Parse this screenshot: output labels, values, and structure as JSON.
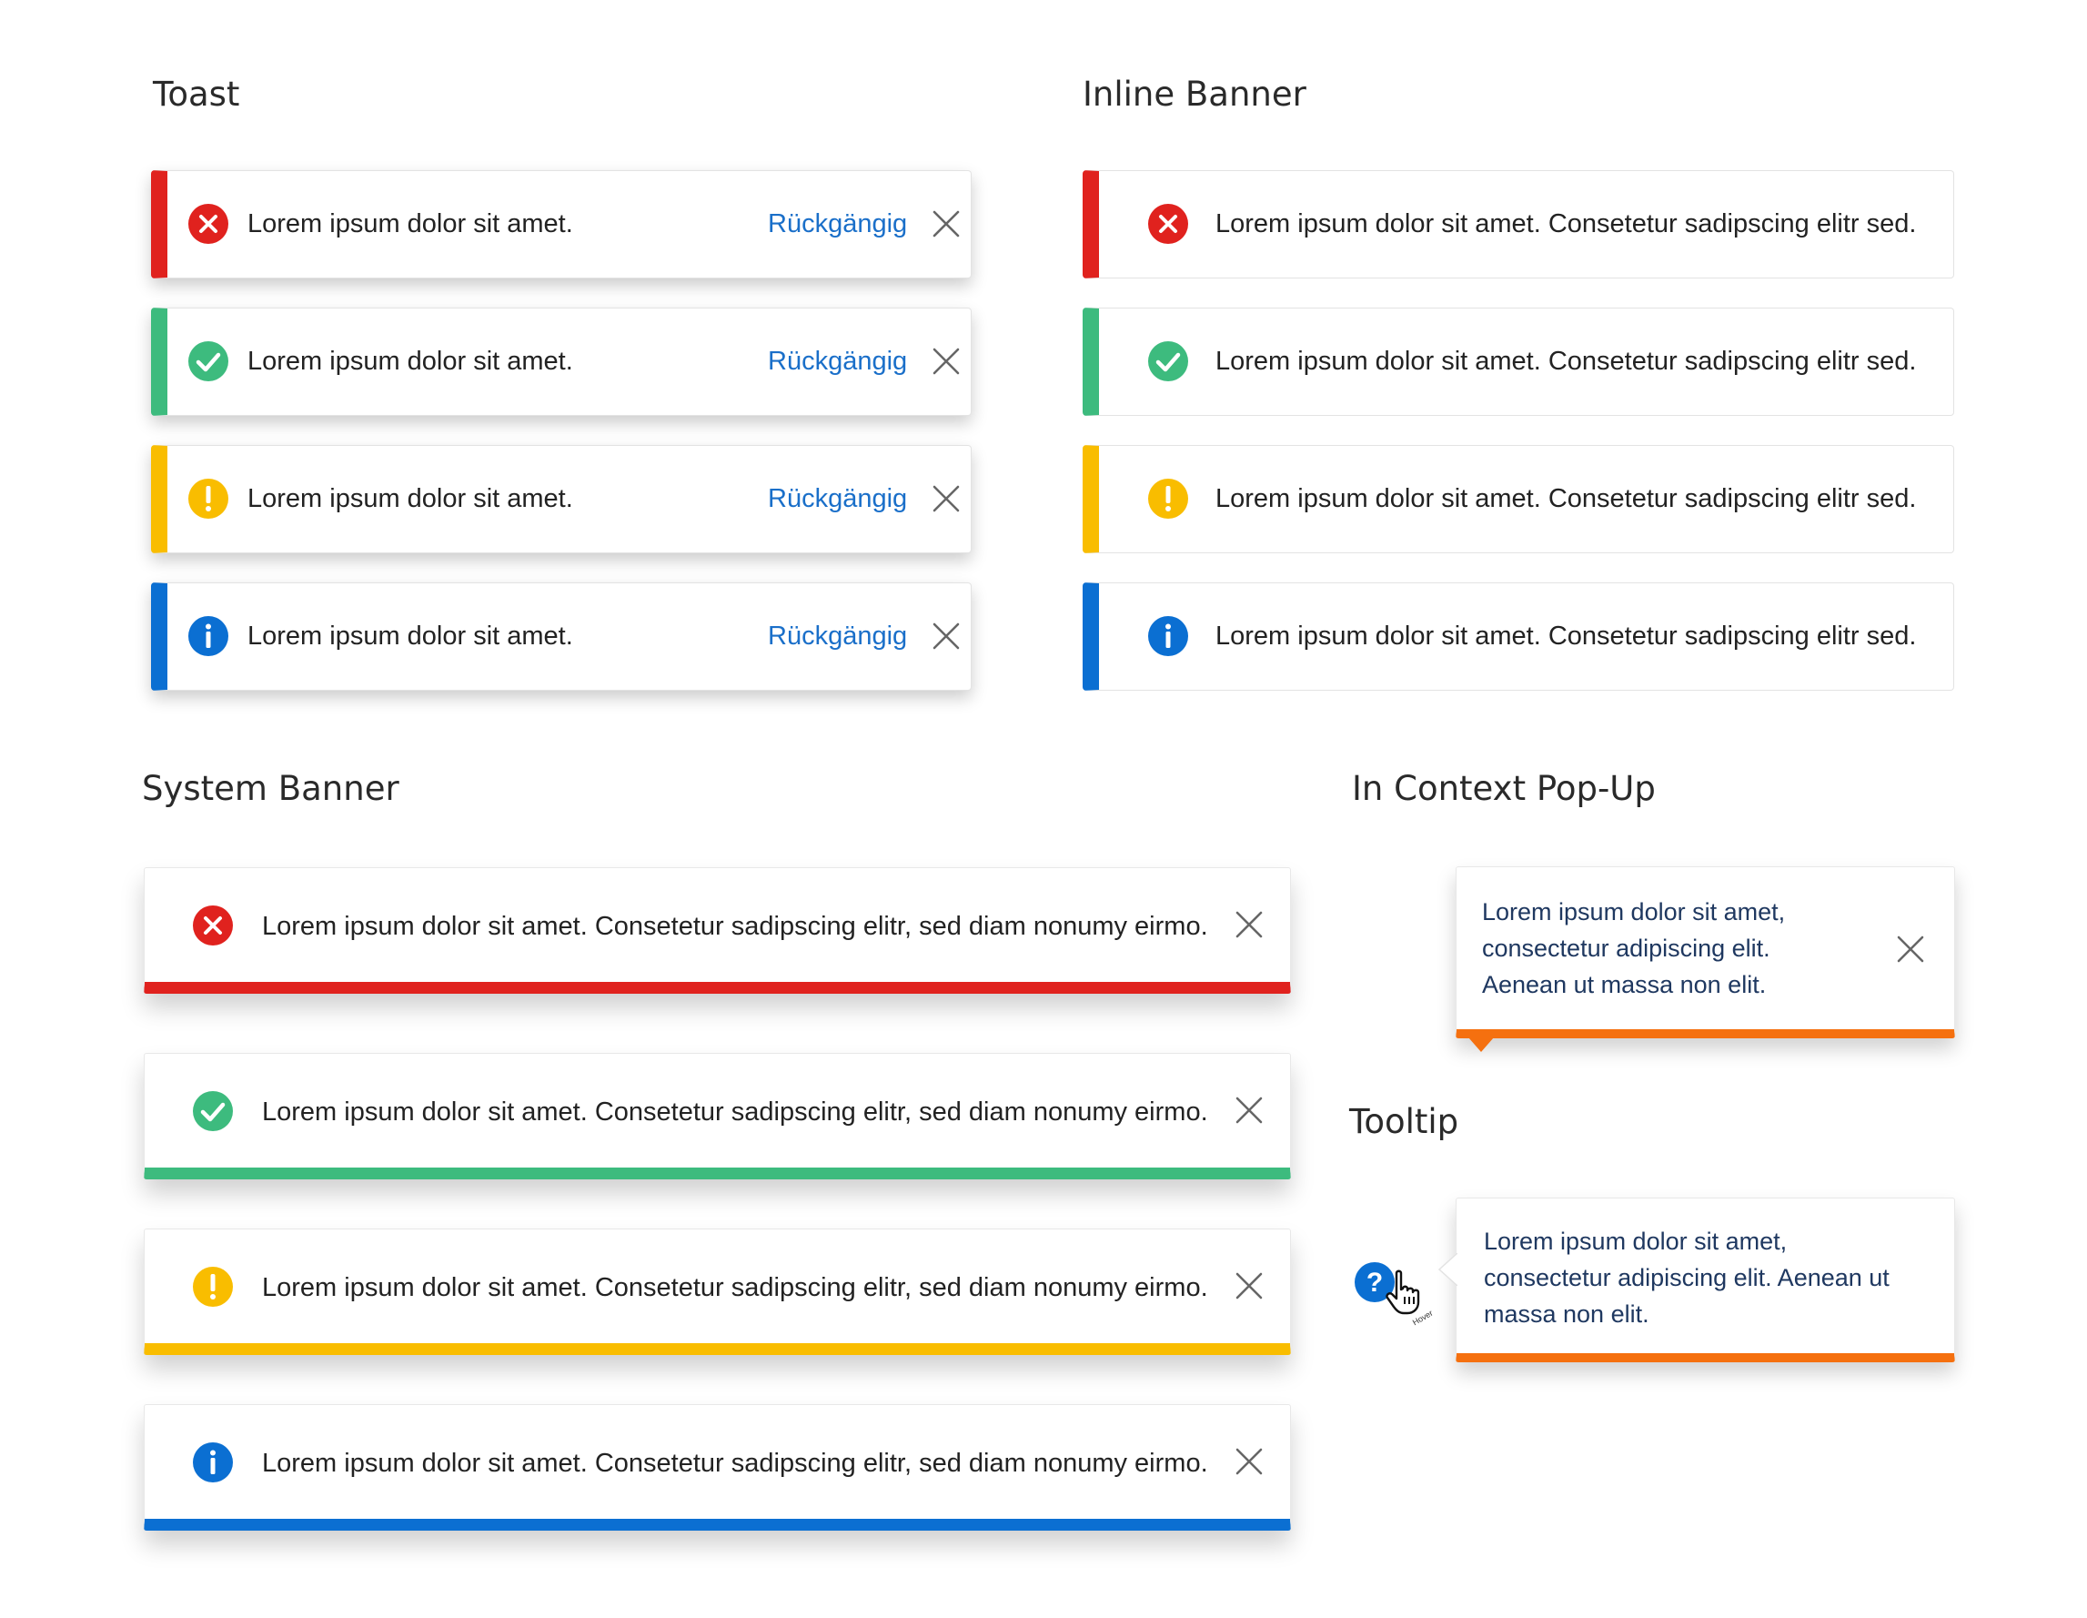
{
  "colors": {
    "error": "#e0221e",
    "success": "#3dbb7e",
    "warning": "#f9bd00",
    "info": "#0b6fd2",
    "accent": "#f5700f",
    "link": "#1a6fc9",
    "popup_text": "#1f3860"
  },
  "sections": {
    "toast": "Toast",
    "inline": "Inline Banner",
    "system": "System Banner",
    "popup": "In Context Pop-Up",
    "tooltip": "Tooltip"
  },
  "toasts": [
    {
      "status": "error",
      "icon": "error-circle-icon",
      "message": "Lorem ipsum dolor sit amet.",
      "action": "Rückgängig"
    },
    {
      "status": "success",
      "icon": "check-circle-icon",
      "message": "Lorem ipsum dolor sit amet.",
      "action": "Rückgängig"
    },
    {
      "status": "warning",
      "icon": "warning-circle-icon",
      "message": "Lorem ipsum dolor sit amet.",
      "action": "Rückgängig"
    },
    {
      "status": "info",
      "icon": "info-circle-icon",
      "message": "Lorem ipsum dolor sit amet.",
      "action": "Rückgängig"
    }
  ],
  "inline_banners": [
    {
      "status": "error",
      "icon": "error-circle-icon",
      "message": "Lorem ipsum dolor sit amet. Consetetur sadipscing elitr sed."
    },
    {
      "status": "success",
      "icon": "check-circle-icon",
      "message": "Lorem ipsum dolor sit amet. Consetetur sadipscing elitr sed."
    },
    {
      "status": "warning",
      "icon": "warning-circle-icon",
      "message": "Lorem ipsum dolor sit amet. Consetetur sadipscing elitr sed."
    },
    {
      "status": "info",
      "icon": "info-circle-icon",
      "message": "Lorem ipsum dolor sit amet. Consetetur sadipscing elitr sed."
    }
  ],
  "system_banners": [
    {
      "status": "error",
      "icon": "error-circle-icon",
      "message": "Lorem ipsum dolor sit amet. Consetetur sadipscing elitr, sed diam nonumy eirmo."
    },
    {
      "status": "success",
      "icon": "check-circle-icon",
      "message": "Lorem ipsum dolor sit amet. Consetetur sadipscing elitr, sed diam nonumy eirmo."
    },
    {
      "status": "warning",
      "icon": "warning-circle-icon",
      "message": "Lorem ipsum dolor sit amet. Consetetur sadipscing elitr, sed diam nonumy eirmo."
    },
    {
      "status": "info",
      "icon": "info-circle-icon",
      "message": "Lorem ipsum dolor sit amet. Consetetur sadipscing elitr, sed diam nonumy eirmo."
    }
  ],
  "context_popup": {
    "lines": [
      "Lorem ipsum dolor sit amet,",
      "consectetur adipiscing elit.",
      "Aenean ut massa non elit."
    ]
  },
  "tooltip": {
    "lines": [
      "Lorem ipsum dolor sit amet,",
      "consectetur adipiscing elit. Aenean ut",
      "massa non elit."
    ],
    "trigger_glyph": "?",
    "cursor_label": "Hover"
  }
}
